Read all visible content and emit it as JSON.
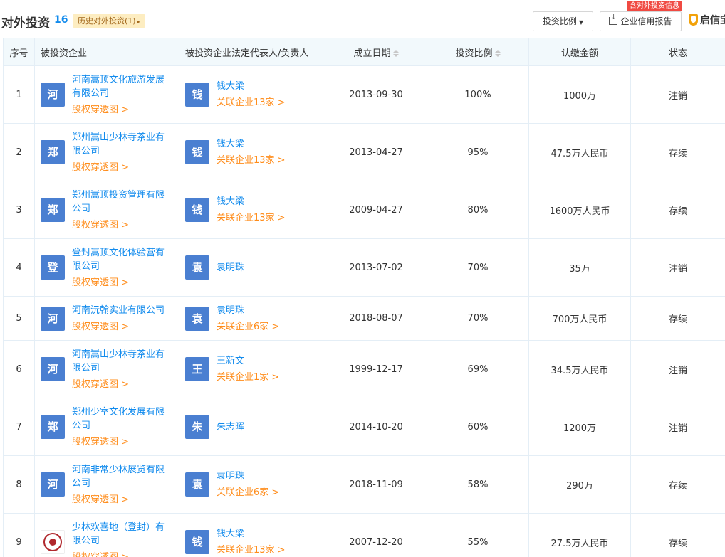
{
  "header": {
    "title": "对外投资",
    "count": "16",
    "history_tag": "历史对外投资(1)",
    "ratio_button": "投资比例",
    "report_badge": "含对外投资信息",
    "report_button": "企业信用报告",
    "qixin_label": "启信宝"
  },
  "columns": {
    "index": "序号",
    "company": "被投资企业",
    "representative": "被投资企业法定代表人/负责人",
    "date": "成立日期",
    "ratio": "投资比例",
    "amount": "认缴金额",
    "status": "状态"
  },
  "colors": {
    "logo_blue": "#4a7fd1",
    "link_blue": "#128bed",
    "link_orange": "#ff8c1a"
  },
  "rows": [
    {
      "index": "1",
      "logo_char": "河",
      "company": "河南嵩顶文化旅游发展有限公司",
      "equity_link": "股权穿透图 >",
      "person_char": "钱",
      "person": "钱大梁",
      "related": "关联企业13家 >",
      "date": "2013-09-30",
      "ratio": "100%",
      "amount": "1000万",
      "status": "注销"
    },
    {
      "index": "2",
      "logo_char": "郑",
      "company": "郑州嵩山少林寺茶业有限公司",
      "equity_link": "股权穿透图 >",
      "person_char": "钱",
      "person": "钱大梁",
      "related": "关联企业13家 >",
      "date": "2013-04-27",
      "ratio": "95%",
      "amount": "47.5万人民币",
      "status": "存续"
    },
    {
      "index": "3",
      "logo_char": "郑",
      "company": "郑州嵩顶投资管理有限公司",
      "equity_link": "股权穿透图 >",
      "person_char": "钱",
      "person": "钱大梁",
      "related": "关联企业13家 >",
      "date": "2009-04-27",
      "ratio": "80%",
      "amount": "1600万人民币",
      "status": "存续"
    },
    {
      "index": "4",
      "logo_char": "登",
      "company": "登封嵩顶文化体验营有限公司",
      "equity_link": "股权穿透图 >",
      "person_char": "袁",
      "person": "袁明珠",
      "related": "",
      "date": "2013-07-02",
      "ratio": "70%",
      "amount": "35万",
      "status": "注销"
    },
    {
      "index": "5",
      "logo_char": "河",
      "company": "河南沅翰实业有限公司",
      "equity_link": "股权穿透图 >",
      "person_char": "袁",
      "person": "袁明珠",
      "related": "关联企业6家 >",
      "date": "2018-08-07",
      "ratio": "70%",
      "amount": "700万人民币",
      "status": "存续"
    },
    {
      "index": "6",
      "logo_char": "河",
      "company": "河南嵩山少林寺茶业有限公司",
      "equity_link": "股权穿透图 >",
      "person_char": "王",
      "person": "王新文",
      "related": "关联企业1家 >",
      "date": "1999-12-17",
      "ratio": "69%",
      "amount": "34.5万人民币",
      "status": "注销"
    },
    {
      "index": "7",
      "logo_char": "郑",
      "company": "郑州少室文化发展有限公司",
      "equity_link": "股权穿透图 >",
      "person_char": "朱",
      "person": "朱志晖",
      "related": "",
      "date": "2014-10-20",
      "ratio": "60%",
      "amount": "1200万",
      "status": "注销"
    },
    {
      "index": "8",
      "logo_char": "河",
      "company": "河南非常少林展览有限公司",
      "equity_link": "股权穿透图 >",
      "person_char": "袁",
      "person": "袁明珠",
      "related": "关联企业6家 >",
      "date": "2018-11-09",
      "ratio": "58%",
      "amount": "290万",
      "status": "存续"
    },
    {
      "index": "9",
      "logo_char": "",
      "company": "少林欢喜地（登封）有限公司",
      "equity_link": "股权穿透图 >",
      "person_char": "钱",
      "person": "钱大梁",
      "related": "关联企业13家 >",
      "date": "2007-12-20",
      "ratio": "55%",
      "amount": "27.5万人民币",
      "status": "存续"
    }
  ]
}
